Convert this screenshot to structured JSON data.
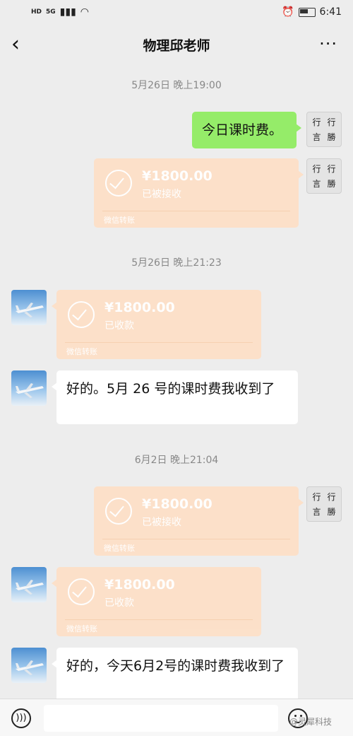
{
  "status_bar": {
    "left_labels": [
      "HD",
      "5G"
    ],
    "time": "6:41"
  },
  "header": {
    "title": "物理邱老师",
    "back_icon": "chevron-left-icon",
    "more_label": "···"
  },
  "messages": [
    {
      "type": "time",
      "text": "5月26日 晚上19:00"
    },
    {
      "type": "text",
      "side": "right",
      "text": "今日课时费。"
    },
    {
      "type": "transfer",
      "side": "right",
      "amount": "¥1800.00",
      "status": "已被接收",
      "brand": "微信转账"
    },
    {
      "type": "time",
      "text": "5月26日 晚上21:23"
    },
    {
      "type": "transfer",
      "side": "left",
      "amount": "¥1800.00",
      "status": "已收款",
      "brand": "微信转账"
    },
    {
      "type": "text",
      "side": "left",
      "text": "好的。5月 26 号的课时费我收到了"
    },
    {
      "type": "time",
      "text": "6月2日 晚上21:04"
    },
    {
      "type": "transfer",
      "side": "right",
      "amount": "¥1800.00",
      "status": "已被接收",
      "brand": "微信转账"
    },
    {
      "type": "transfer",
      "side": "left",
      "amount": "¥1800.00",
      "status": "已收款",
      "brand": "微信转账"
    },
    {
      "type": "text",
      "side": "left",
      "text": "好的，今天6月2号的课时费我收到了"
    }
  ],
  "self_avatar_chars": [
    "行",
    "行",
    "言",
    "勝"
  ],
  "input_bar": {
    "placeholder": "",
    "voice_icon": "voice-icon",
    "emoji_icon": "emoji-icon"
  },
  "watermark": "@灵犀科技"
}
